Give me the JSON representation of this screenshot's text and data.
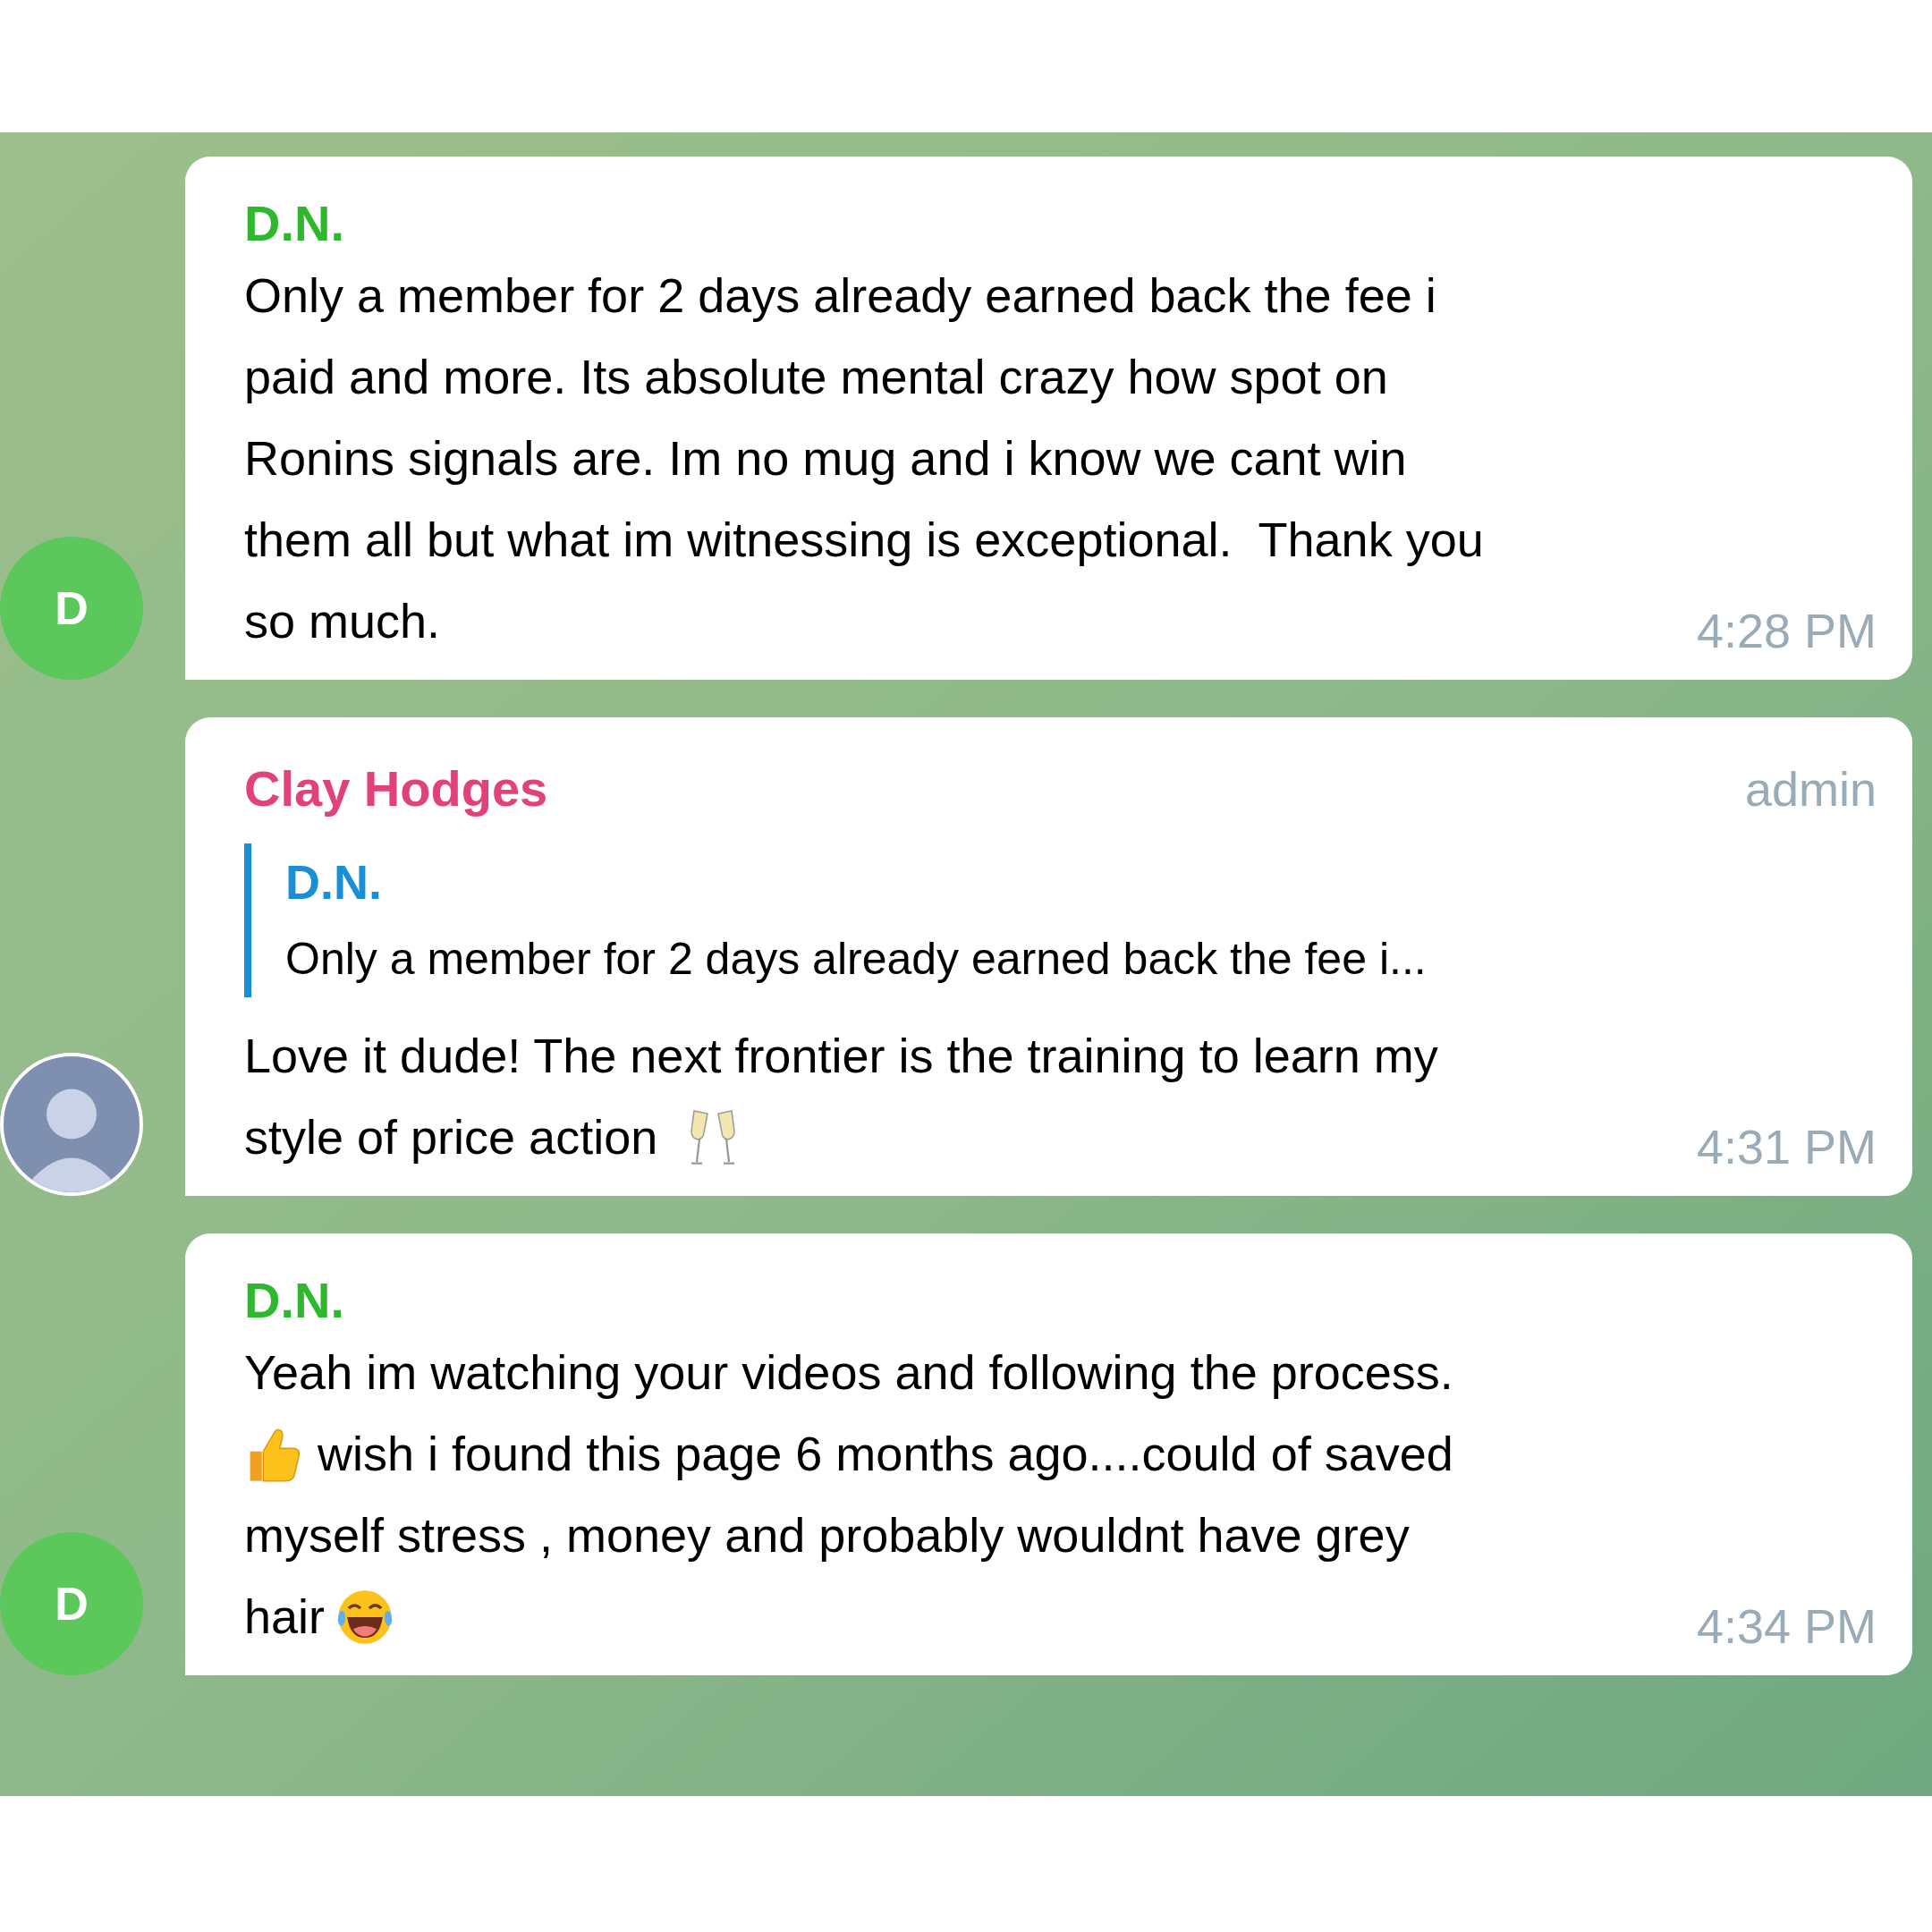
{
  "messages": [
    {
      "sender": "D.N.",
      "color": "#2eb82e",
      "avatar": {
        "kind": "letter",
        "letter": "D",
        "color": "#5cc85c"
      },
      "body": [
        "Only a member for 2 days already earned back the fee i",
        "paid and more. Its absolute mental crazy how spot on",
        "Ronins signals are. Im no mug and i know we cant win",
        "them all but what im witnessing is exceptional.  Thank you",
        "so much."
      ],
      "time": "4:28 PM"
    },
    {
      "sender": "Clay Hodges",
      "color": "#e2427c",
      "badge": "admin",
      "avatar": {
        "kind": "photo"
      },
      "reply": {
        "sender": "D.N.",
        "text": "Only a member for 2 days already earned back the fee i..."
      },
      "body": [
        "Love it dude! The next frontier is the training to learn my",
        "style of price action"
      ],
      "time": "4:31 PM"
    },
    {
      "sender": "D.N.",
      "color": "#2eb82e",
      "avatar": {
        "kind": "letter",
        "letter": "D",
        "color": "#5cc85c"
      },
      "body": [
        "Yeah im watching your videos and following the process.",
        "wish i found this page 6 months ago....could of saved",
        "myself stress , money and probably wouldnt have grey",
        "hair"
      ],
      "time": "4:34 PM"
    }
  ]
}
